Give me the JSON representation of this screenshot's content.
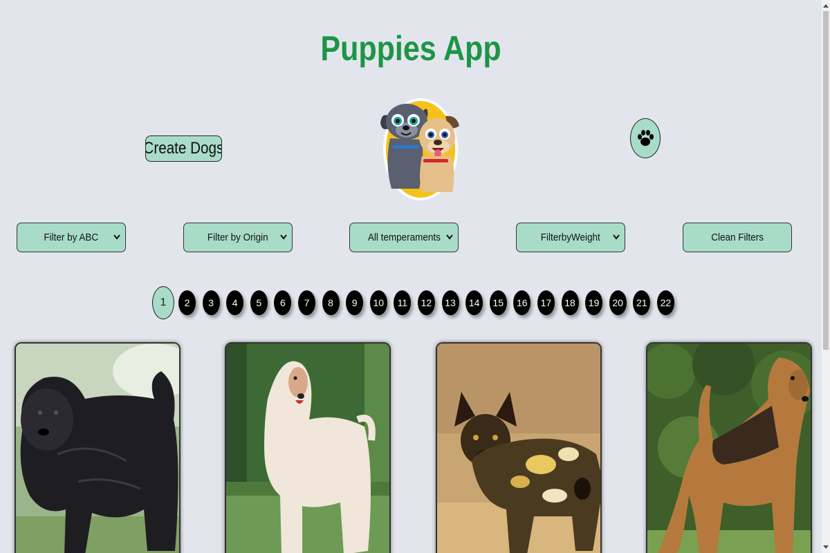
{
  "app": {
    "title": "Puppies App"
  },
  "actions": {
    "create_label": "Create Dogs",
    "search_icon": "paw-icon"
  },
  "filters": [
    {
      "label": "Filter by ABC"
    },
    {
      "label": "Filter by Origin"
    },
    {
      "label": "All temperaments"
    },
    {
      "label": "FilterbyWeight"
    }
  ],
  "clean_label": "Clean Filters",
  "pagination": {
    "current": "1",
    "pages": [
      "1",
      "2",
      "3",
      "4",
      "5",
      "6",
      "7",
      "8",
      "9",
      "10",
      "11",
      "12",
      "13",
      "14",
      "15",
      "16",
      "17",
      "18",
      "19",
      "20",
      "21",
      "22"
    ]
  },
  "cards": [
    {
      "image": "black-shaggy-dog-photo"
    },
    {
      "image": "afghan-hound-photo"
    },
    {
      "image": "african-wild-dog-photo"
    },
    {
      "image": "airedale-terrier-photo"
    }
  ],
  "colors": {
    "background": "#e2e6ec",
    "title": "#1e9446",
    "accent": "#a8dcc9",
    "page_dot": "#000000"
  }
}
